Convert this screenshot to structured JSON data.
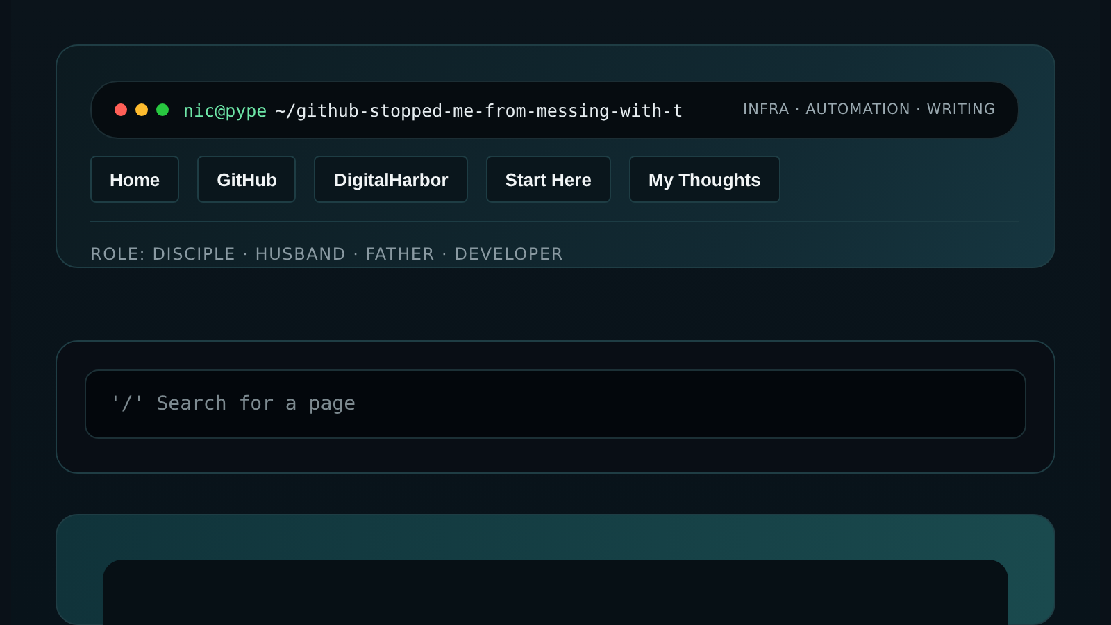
{
  "terminal": {
    "user": "nic@pype",
    "path": "~/github-stopped-me-from-messing-with-t",
    "tags": "INFRA · AUTOMATION · WRITING"
  },
  "nav": [
    "Home",
    "GitHub",
    "DigitalHarbor",
    "Start Here",
    "My Thoughts"
  ],
  "role": "ROLE: DISCIPLE · HUSBAND · FATHER · DEVELOPER",
  "search": {
    "placeholder": "'/' Search for a page"
  }
}
